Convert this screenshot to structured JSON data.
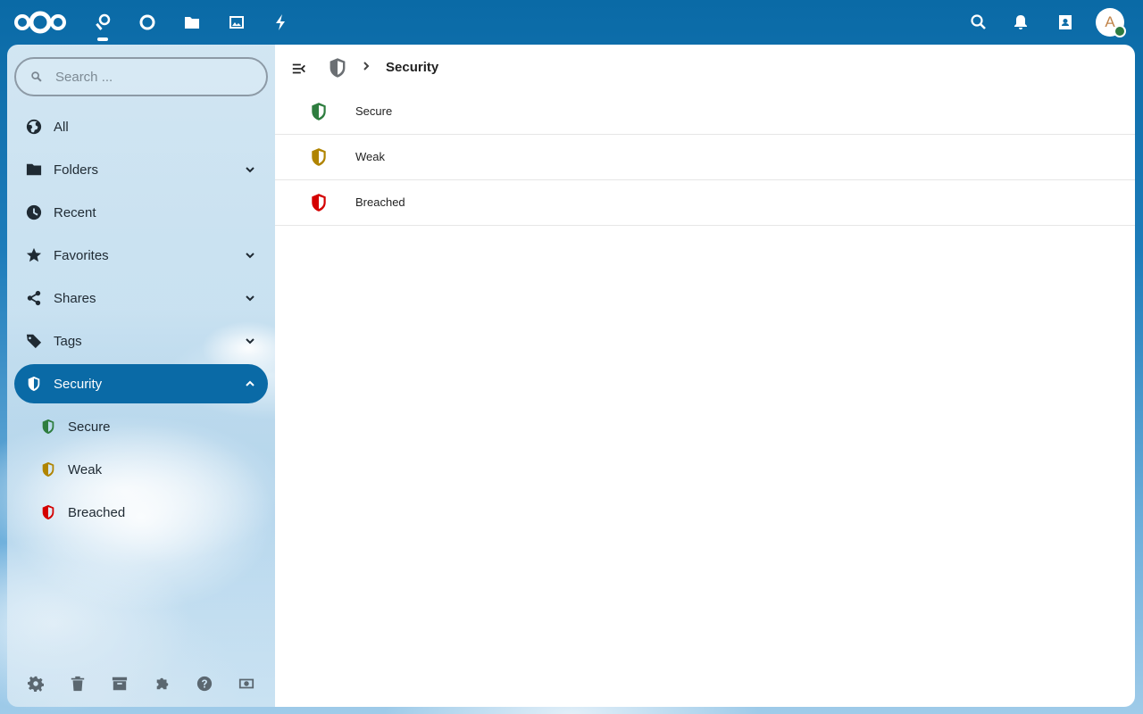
{
  "header": {
    "apps": [
      {
        "name": "Passwords",
        "icon": "key-icon",
        "active": true
      },
      {
        "name": "Dashboard",
        "icon": "circle-icon"
      },
      {
        "name": "Files",
        "icon": "folder-icon"
      },
      {
        "name": "Photos",
        "icon": "image-icon"
      },
      {
        "name": "Activity",
        "icon": "lightning-icon"
      }
    ],
    "avatar_initial": "A"
  },
  "sidebar": {
    "search": {
      "placeholder": "Search ..."
    },
    "items": [
      {
        "label": "All",
        "icon": "globe-icon"
      },
      {
        "label": "Folders",
        "icon": "folder-icon",
        "expandable": true
      },
      {
        "label": "Recent",
        "icon": "clock-icon"
      },
      {
        "label": "Favorites",
        "icon": "star-icon",
        "expandable": true
      },
      {
        "label": "Shares",
        "icon": "share-icon",
        "expandable": true
      },
      {
        "label": "Tags",
        "icon": "tag-icon",
        "expandable": true
      },
      {
        "label": "Security",
        "icon": "shield-icon",
        "expandable": true,
        "active": true
      }
    ],
    "security_children": [
      {
        "label": "Secure",
        "color": "#2e7d3f"
      },
      {
        "label": "Weak",
        "color": "#b08400"
      },
      {
        "label": "Breached",
        "color": "#d40000"
      }
    ],
    "footer_icons": [
      "settings-icon",
      "trash-icon",
      "archive-icon",
      "puzzle-icon",
      "help-icon",
      "donate-icon"
    ]
  },
  "main": {
    "breadcrumb_title": "Security",
    "rows": [
      {
        "label": "Secure",
        "color": "#2e7d3f"
      },
      {
        "label": "Weak",
        "color": "#b08400"
      },
      {
        "label": "Breached",
        "color": "#d40000"
      }
    ]
  },
  "colors": {
    "primary": "#0a6aa6",
    "secure": "#2e7d3f",
    "weak": "#b08400",
    "breached": "#d40000"
  }
}
